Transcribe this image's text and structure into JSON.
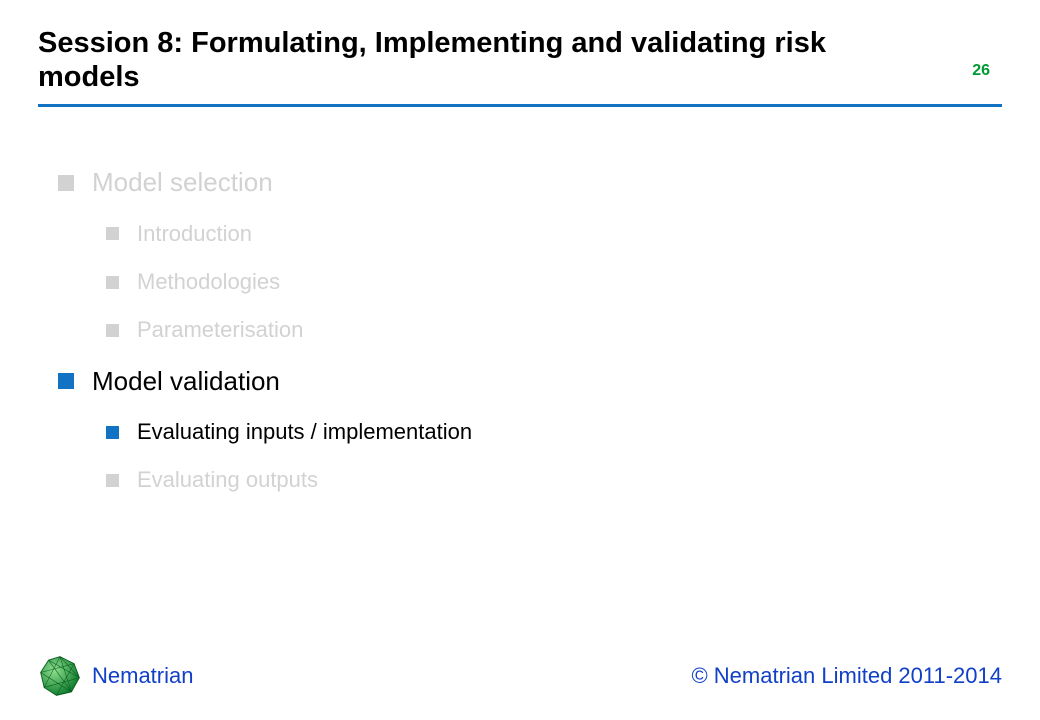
{
  "header": {
    "title": "Session 8: Formulating, Implementing and validating risk models",
    "page_number": "26"
  },
  "outline": [
    {
      "level": 0,
      "label": "Model selection",
      "active": false
    },
    {
      "level": 1,
      "label": "Introduction",
      "active": false
    },
    {
      "level": 1,
      "label": "Methodologies",
      "active": false
    },
    {
      "level": 1,
      "label": "Parameterisation",
      "active": false
    },
    {
      "level": 0,
      "label": "Model validation",
      "active": true
    },
    {
      "level": 1,
      "label": "Evaluating inputs / implementation",
      "active": true
    },
    {
      "level": 1,
      "label": "Evaluating outputs",
      "active": false
    }
  ],
  "footer": {
    "brand": "Nematrian",
    "copyright": "© Nematrian Limited 2011-2014"
  },
  "colors": {
    "rule": "#1273c4",
    "accent_green": "#009933",
    "brand_blue": "#1140c8",
    "inactive_gray": "#d2d2d2"
  }
}
